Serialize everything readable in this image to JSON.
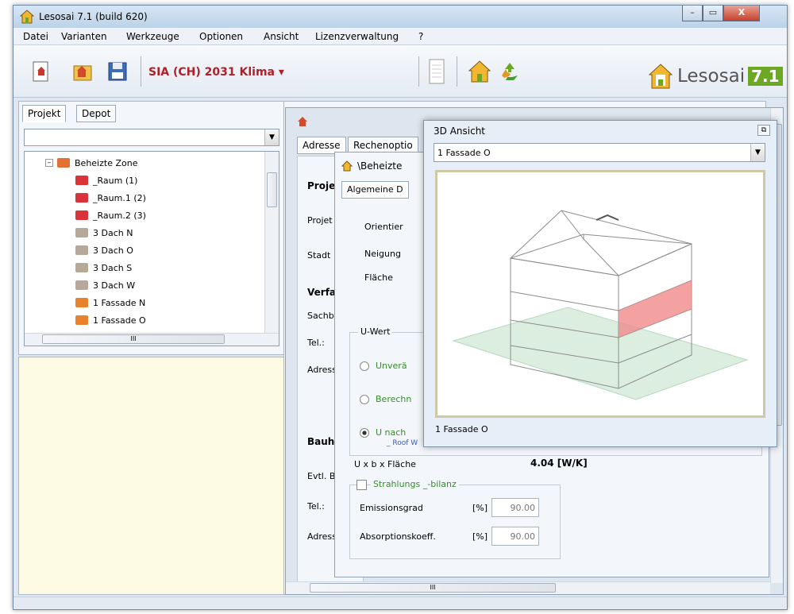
{
  "window": {
    "title": "Lesosai 7.1 (build 620)",
    "min": "–",
    "max": "▭",
    "close": "X"
  },
  "menu": [
    "Datei",
    "Varianten",
    "Werkzeuge",
    "Optionen",
    "Ansicht",
    "Lizenzverwaltung",
    "?"
  ],
  "toolbar": {
    "climate_label": "SIA (CH) 2031 Klima ▾"
  },
  "brand": {
    "text": "Lesosai",
    "badge": "7.1"
  },
  "left": {
    "tabs": [
      "Projekt",
      "Depot"
    ],
    "tree": [
      {
        "label": "Beheizte Zone",
        "level": 0,
        "icon": "zone-icon"
      },
      {
        "label": "_Raum (1)",
        "level": 1,
        "icon": "room-icon"
      },
      {
        "label": "_Raum.1 (2)",
        "level": 1,
        "icon": "room-icon"
      },
      {
        "label": "_Raum.2 (3)",
        "level": 1,
        "icon": "room-icon"
      },
      {
        "label": "3 Dach N",
        "level": 1,
        "icon": "roof-icon"
      },
      {
        "label": "3 Dach O",
        "level": 1,
        "icon": "roof-icon"
      },
      {
        "label": "3 Dach S",
        "level": 1,
        "icon": "roof-icon"
      },
      {
        "label": "3 Dach W",
        "level": 1,
        "icon": "roof-icon"
      },
      {
        "label": "1 Fassade N",
        "level": 1,
        "icon": "facade-icon"
      },
      {
        "label": "1 Fassade O",
        "level": 1,
        "icon": "facade-icon"
      }
    ],
    "hscroll_mark": "III"
  },
  "doc": {
    "tabs": [
      "Adresse",
      "Rechenoptio"
    ],
    "labels": [
      "Proje",
      "Projet",
      "Stadt",
      "Verfa",
      "Sachbe",
      "Tel.:",
      "Adress",
      "Bauhe",
      "Evtl. B",
      "Tel.:",
      "Adress"
    ],
    "hscroll_mark": "III"
  },
  "inner": {
    "title": "\\Beheizte",
    "tab": "Algemeine D",
    "labels": [
      "Orientier",
      "Neigung",
      "Fläche"
    ],
    "uwert_group": "U-Wert",
    "radios": [
      "Unverä",
      "Berechn",
      "U nach"
    ],
    "roof_note": "_ Roof W",
    "ubxf_label": "U x b x Fläche",
    "ubxf_value": "4.04 [W/K]",
    "strahlung_label": "Strahlungs _-bilanz",
    "emission_label": "Emissionsgrad",
    "emission_unit": "[%]",
    "emission_value": "90.00",
    "absorption_label": "Absorptionskoeff.",
    "absorption_unit": "[%]",
    "absorption_value": "90.00"
  },
  "view3d": {
    "title": "3D Ansicht",
    "selected": "1 Fassade O",
    "caption": "1 Fassade O",
    "highlight_color": "#f08a8a"
  }
}
